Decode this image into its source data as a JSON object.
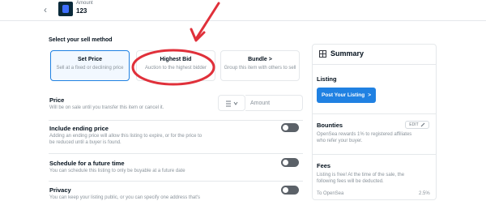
{
  "header": {
    "back_icon": "chevron-left-icon",
    "item_label": "Amount",
    "item_value": "123"
  },
  "sell_method": {
    "title": "Select your sell method",
    "options": [
      {
        "title": "Set Price",
        "description": "Sell at a fixed or declining price",
        "selected": true
      },
      {
        "title": "Highest Bid",
        "description": "Auction to the highest bidder",
        "selected": false
      },
      {
        "title": "Bundle",
        "chevron": ">",
        "description": "Group this item with others to sell",
        "selected": false
      }
    ]
  },
  "price": {
    "title": "Price",
    "description": "Will be on sale until you transfer this item or cancel it.",
    "currency_icon": "ethereum-icon",
    "amount_placeholder": "Amount"
  },
  "ending_price": {
    "title": "Include ending price",
    "description_1": "Adding an ending price will allow this listing to expire, or for the price to",
    "description_2": "be reduced until a buyer is found."
  },
  "future_time": {
    "title": "Schedule for a future time",
    "description": "You can schedule this listing to only be buyable at a future date"
  },
  "privacy": {
    "title": "Privacy",
    "description": "You can keep your listing public, or you can specify one address that's"
  },
  "summary": {
    "title": "Summary",
    "listing_label": "Listing",
    "post_button": "Post Your Listing",
    "post_chevron": ">",
    "bounties_label": "Bounties",
    "edit_label": "EDIT",
    "bounties_desc_1": "OpenSea rewards 1% to registered affiliates",
    "bounties_desc_2": "who refer your buyer.",
    "fees_label": "Fees",
    "fees_desc_1": "Listing is free! At the time of the sale, the",
    "fees_desc_2": "following fees will be deducted.",
    "fee_row_label": "To OpenSea",
    "fee_row_value": "2.5%"
  },
  "colors": {
    "accent": "#2081e2",
    "annotation": "#e0303a"
  }
}
